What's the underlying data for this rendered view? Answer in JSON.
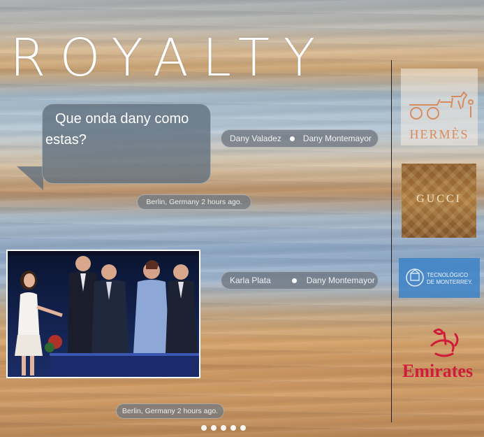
{
  "header": {
    "title": "ROYALTY"
  },
  "post1": {
    "message": "Que onda dany como estas?",
    "participants": {
      "from": "Dany Valadez",
      "to": "Dany Montemayor"
    },
    "meta": "Berlin, Germany 2 hours ago."
  },
  "post2": {
    "participants": {
      "from": "Karla Plata",
      "to": "Dany Montemayor"
    },
    "meta": "Berlin, Germany 2 hours ago."
  },
  "sidebar": {
    "brands": [
      {
        "name": "HERMÈS"
      },
      {
        "name": "GUCCI"
      },
      {
        "name": "TECNOLÓGICO",
        "sub": "DE MONTERREY."
      },
      {
        "name": "Emirates"
      }
    ]
  },
  "pager": {
    "count": 5,
    "active": 0
  },
  "colors": {
    "hermes": "#d88a5f",
    "gucci": "#9a6a35",
    "tec": "#2f6fb5",
    "emirates": "#d01c3a"
  }
}
